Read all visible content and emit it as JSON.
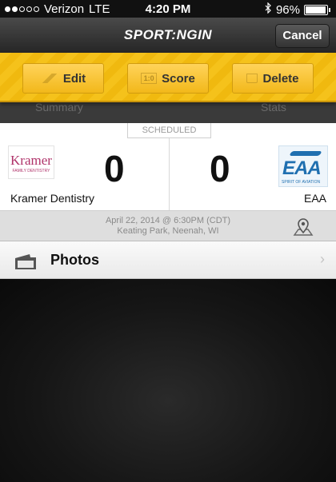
{
  "status_bar": {
    "carrier": "Verizon",
    "network": "LTE",
    "time": "4:20 PM",
    "battery": "96%",
    "battery_level": 0.96
  },
  "nav": {
    "logo": "SPORT:NGIN",
    "cancel_label": "Cancel"
  },
  "actions": {
    "edit_label": "Edit",
    "score_label": "Score",
    "delete_label": "Delete"
  },
  "tabs": [
    "Summary",
    "Stats"
  ],
  "game": {
    "status": "SCHEDULED",
    "home": {
      "name": "Kramer Dentistry",
      "score": "0",
      "logo_text": "Kramer",
      "logo_sub": "FAMILY DENTISTRY"
    },
    "away": {
      "name": "EAA",
      "score": "0",
      "logo_text": "EAA",
      "logo_sub": "SPIRIT OF AVIATION"
    },
    "datetime": "April 22, 2014 @ 6:30PM (CDT)",
    "location": "Keating Park, Neenah, WI"
  },
  "photos": {
    "label": "Photos"
  },
  "colors": {
    "accent": "#f5c21b",
    "nav_bg": "#2e2e2e"
  },
  "icons": [
    "signal-dots-icon",
    "bluetooth-icon",
    "battery-icon",
    "pencil-icon",
    "scoreboard-icon",
    "trash-icon",
    "map-pin-icon",
    "camera-icon",
    "chevron-right-icon"
  ]
}
